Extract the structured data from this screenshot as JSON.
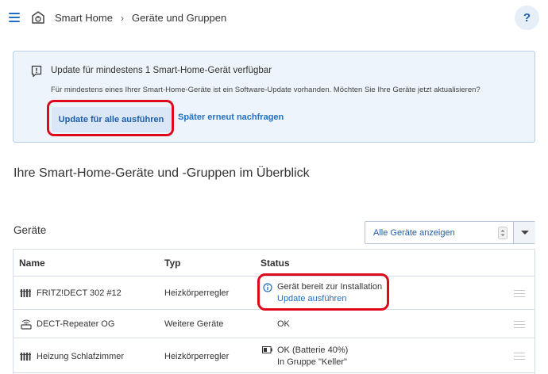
{
  "header": {
    "breadcrumb_home": "Smart Home",
    "breadcrumb_separator": "›",
    "breadcrumb_current": "Geräte und Gruppen",
    "help_label": "?"
  },
  "notice": {
    "title": "Update für mindestens 1 Smart-Home-Gerät verfügbar",
    "text": "Für mindestens eines Ihrer Smart-Home-Geräte ist ein Software-Update vorhanden. Möchten Sie Ihre Geräte jetzt aktualisieren?",
    "primary_button": "Update für alle ausführen",
    "secondary_button": "Später erneut nachfragen"
  },
  "overview_title": "Ihre Smart-Home-Geräte und -Gruppen im Überblick",
  "devices": {
    "title": "Geräte",
    "filter_value": "Alle Geräte anzeigen",
    "columns": {
      "name": "Name",
      "type": "Typ",
      "status": "Status"
    },
    "rows": [
      {
        "icon": "radiator-icon",
        "name": "FRITZ!DECT 302 #12",
        "type": "Heizkörperregler",
        "status": "Gerät bereit zur Installation",
        "status_link": "Update ausführen"
      },
      {
        "icon": "repeater-icon",
        "name": "DECT-Repeater OG",
        "type": "Weitere Geräte",
        "status": "OK",
        "status_detail": ""
      },
      {
        "icon": "radiator-icon",
        "name": "Heizung Schlafzimmer",
        "type": "Heizkörperregler",
        "status": "OK (Batterie 40%)",
        "status_detail": "In Gruppe \"Keller\""
      }
    ]
  },
  "colors": {
    "accent": "#1f6fc5",
    "notice_bg": "#eef4fb",
    "highlight": "#e0081c"
  }
}
